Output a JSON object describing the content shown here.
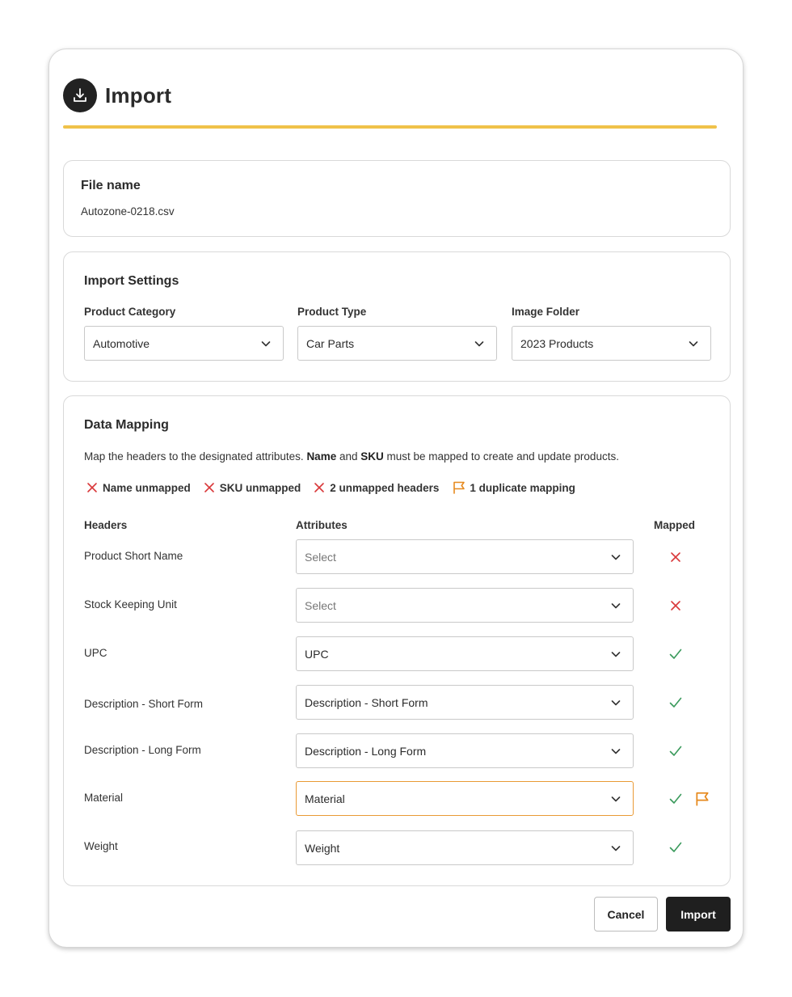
{
  "dialog": {
    "title": "Import",
    "icon": "download-icon",
    "accent_color": "#f0c24a"
  },
  "file": {
    "label": "File name",
    "value": "Autozone-0218.csv"
  },
  "settings": {
    "title": "Import Settings",
    "fields": [
      {
        "label": "Product Category",
        "value": "Automotive"
      },
      {
        "label": "Product Type",
        "value": "Car Parts"
      },
      {
        "label": "Image Folder",
        "value": "2023 Products"
      }
    ]
  },
  "mapping": {
    "title": "Data Mapping",
    "desc_prefix": "Map the headers to the designated attributes. ",
    "desc_name": "Name",
    "desc_and": " and ",
    "desc_sku": "SKU",
    "desc_suffix": " must be mapped to create and update products.",
    "status": [
      {
        "label": "Name unmapped",
        "icon": "x-icon",
        "color": "#d9383a"
      },
      {
        "label": "SKU unmapped",
        "icon": "x-icon",
        "color": "#d9383a"
      },
      {
        "label": "2 unmapped headers",
        "icon": "x-icon",
        "color": "#d9383a"
      },
      {
        "label": "1 duplicate mapping",
        "icon": "flag-icon",
        "color": "#e68a1f"
      }
    ],
    "columns": {
      "headers": "Headers",
      "attributes": "Attributes",
      "mapped": "Mapped"
    },
    "rows": [
      {
        "header": "Product Short Name",
        "attribute": "Select",
        "placeholder": true,
        "mapped": false,
        "duplicate": false
      },
      {
        "header": "Stock Keeping Unit",
        "attribute": "Select",
        "placeholder": true,
        "mapped": false,
        "duplicate": false
      },
      {
        "header": "UPC",
        "attribute": "UPC",
        "placeholder": false,
        "mapped": true,
        "duplicate": false
      },
      {
        "header": "Description - Short Form",
        "attribute": "Description - Short Form",
        "placeholder": false,
        "mapped": true,
        "duplicate": false
      },
      {
        "header": "Description - Long Form",
        "attribute": "Description - Long Form",
        "placeholder": false,
        "mapped": true,
        "duplicate": false
      },
      {
        "header": "Material",
        "attribute": "Material",
        "placeholder": false,
        "mapped": true,
        "duplicate": true
      },
      {
        "header": "Weight",
        "attribute": "Weight",
        "placeholder": false,
        "mapped": true,
        "duplicate": false
      }
    ]
  },
  "buttons": {
    "cancel": "Cancel",
    "import": "Import"
  },
  "colors": {
    "error": "#d9383a",
    "success": "#3a9a5c",
    "warning": "#e68a1f",
    "primary_button": "#1f1f1f"
  }
}
